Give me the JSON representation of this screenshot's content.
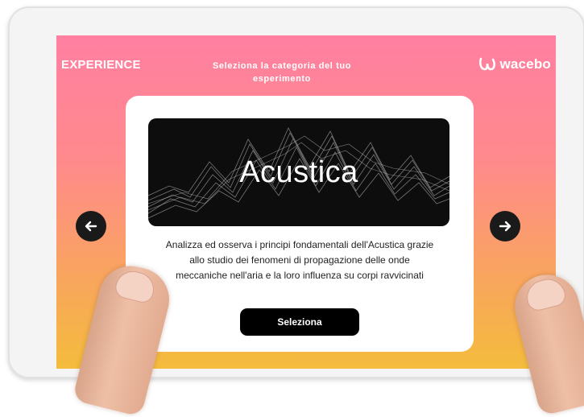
{
  "header": {
    "left_label": "EXPERIENCE",
    "title": "Seleziona la categoria del tuo esperimento",
    "logo_text": "wacebo"
  },
  "card": {
    "banner_title": "Acustica",
    "description": "Analizza ed osserva i principi fondamentali dell'Acustica grazie allo studio dei fenomeni di propagazione delle onde meccaniche nell'aria e la loro influenza su corpi ravvicinati",
    "select_label": "Seleziona"
  },
  "navigation": {
    "prev_icon": "arrow-left-icon",
    "next_icon": "arrow-right-icon"
  },
  "colors": {
    "gradient_top": "#ff7fa1",
    "gradient_bottom": "#f4bc3c",
    "button": "#000000",
    "card": "#ffffff"
  }
}
